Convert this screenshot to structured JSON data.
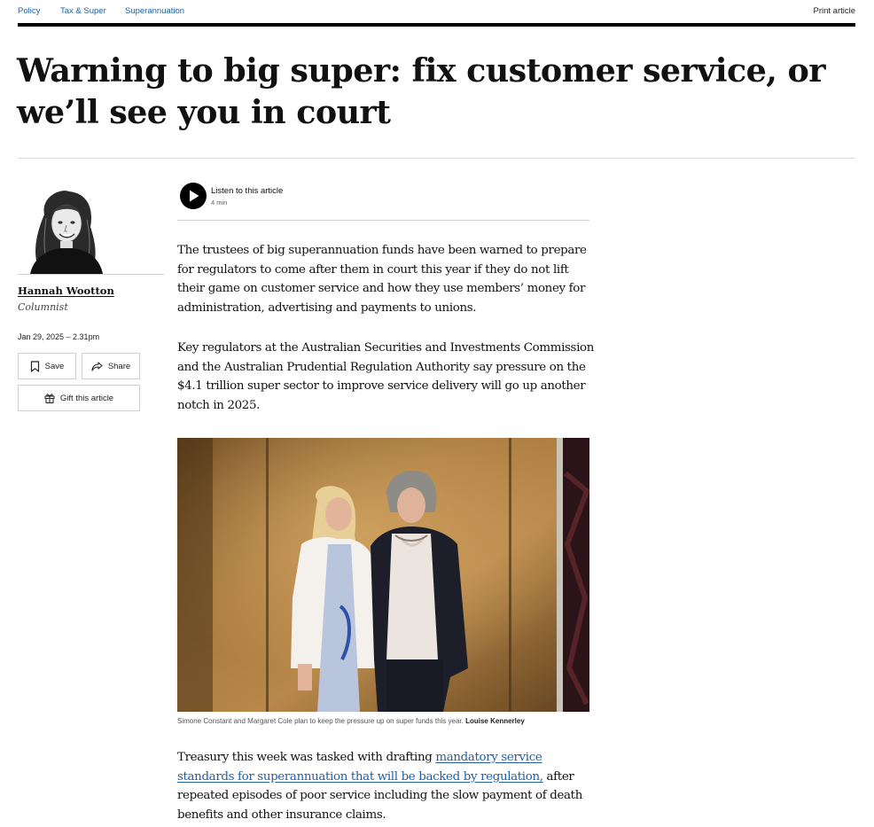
{
  "nav": {
    "categories": [
      "Policy",
      "Tax & Super",
      "Superannuation"
    ],
    "print_label": "Print article"
  },
  "article": {
    "headline": "Warning to big super: fix customer service, or we’ll see you in court",
    "author": {
      "name": "Hannah Wootton",
      "role": "Columnist"
    },
    "date": "Jan 29, 2025 – 2.31pm",
    "actions": {
      "save": "Save",
      "share": "Share",
      "gift": "Gift this article"
    },
    "listen": {
      "title": "Listen to this article",
      "duration": "4 min"
    },
    "paragraphs": [
      "The trustees of big superannuation funds have been warned to prepare for regulators to come after them in court this year if they do not lift their game on customer service and how they use members’ money for administration, advertising and payments to unions.",
      "Key regulators at the Australian Securities and Investments Commission and the Australian Prudential Regulation Authority say pressure on the $4.1 trillion super sector to improve service delivery will go up another notch in 2025."
    ],
    "photo": {
      "caption": "Simone Constant and Margaret Cole plan to keep the pressure up on super funds this year.",
      "credit": "Louise Kennerley"
    },
    "p3": {
      "before": "Treasury this week was tasked with drafting ",
      "link": "mandatory service standards for superannuation that will be backed by regulation,",
      "after": " after repeated episodes of poor service including the slow payment of death benefits and other insurance claims."
    }
  },
  "colors": {
    "link": "#1f5fa6",
    "rule": "#000000",
    "text": "#111111"
  }
}
